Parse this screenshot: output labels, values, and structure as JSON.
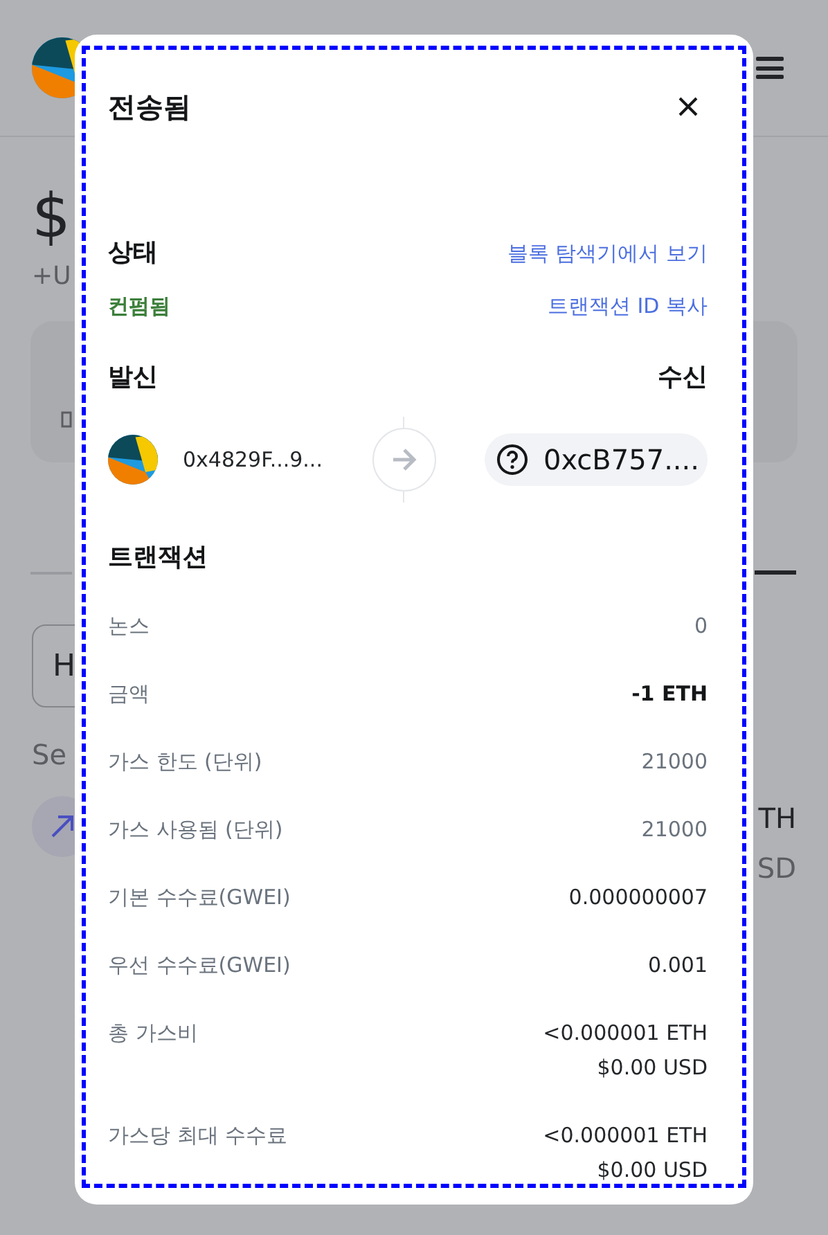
{
  "background": {
    "balance": "$",
    "change": "+U",
    "field_text": "H",
    "section_label": "Se",
    "token_amount": "TH",
    "token_fiat": "SD"
  },
  "modal": {
    "title": "전송됨",
    "status": {
      "label": "상태",
      "value": "컨펌됨",
      "links": [
        "블록 탐색기에서 보기",
        "트랜잭션 ID 복사"
      ]
    },
    "from": {
      "label": "발신",
      "address": "0x4829F...9..."
    },
    "to": {
      "label": "수신",
      "address": "0xcB757...."
    },
    "details": {
      "title": "트랜잭션",
      "rows": [
        {
          "label": "논스",
          "kind": "muted",
          "lines": [
            "0"
          ]
        },
        {
          "label": "금액",
          "kind": "strong",
          "lines": [
            "-1 ETH"
          ]
        },
        {
          "label": "가스 한도 (단위)",
          "kind": "muted",
          "lines": [
            "21000"
          ]
        },
        {
          "label": "가스 사용됨 (단위)",
          "kind": "muted",
          "lines": [
            "21000"
          ]
        },
        {
          "label": "기본 수수료(GWEI)",
          "kind": "normal",
          "lines": [
            "0.000000007"
          ]
        },
        {
          "label": "우선 수수료(GWEI)",
          "kind": "normal",
          "lines": [
            "0.001"
          ]
        },
        {
          "label": "총 가스비",
          "kind": "normal",
          "lines": [
            "<0.000001 ETH",
            "$0.00 USD"
          ]
        },
        {
          "label": "가스당 최대 수수료",
          "kind": "normal",
          "lines": [
            "<0.000001 ETH",
            "$0.00 USD"
          ]
        }
      ]
    }
  }
}
